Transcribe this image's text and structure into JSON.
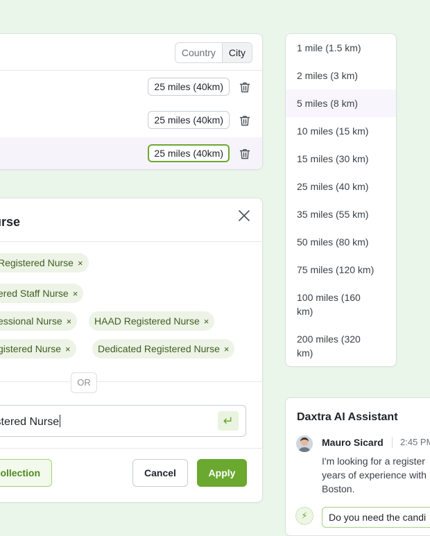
{
  "location": {
    "toggle": {
      "country": "Country",
      "city": "City",
      "active": "City"
    },
    "rows": [
      {
        "distance": "25 miles (40km)",
        "selected": false
      },
      {
        "distance": "25 miles (40km)",
        "selected": false
      },
      {
        "distance": "25 miles (40km)",
        "selected": true
      }
    ]
  },
  "distance_options": [
    "1 mile (1.5 km)",
    "2 miles (3 km)",
    "5 miles (8 km)",
    "10 miles (15 km)",
    "15 miles (30 km)",
    "25 miles (40 km)",
    "35 miles (55 km)",
    "50 miles (80 km)",
    "75 miles (120 km)",
    "100 miles (160 km)",
    "200 miles (320 km)"
  ],
  "distance_options_split": [
    [
      "1 mile (1.5 km)"
    ],
    [
      "2 miles (3 km)"
    ],
    [
      "5 miles (8 km)"
    ],
    [
      "10 miles (15 km)"
    ],
    [
      "15 miles (30 km)"
    ],
    [
      "25 miles (40 km)"
    ],
    [
      "35 miles (55 km)"
    ],
    [
      "50 miles (80 km)"
    ],
    [
      "75 miles (120 km)"
    ],
    [
      "100 miles (160",
      "km)"
    ],
    [
      "200 miles (320",
      "km)"
    ]
  ],
  "modal": {
    "title": "urse",
    "tags": [
      {
        "label": "Registered Nurse",
        "remove": "×"
      },
      {
        "label": "ered Staff Nurse",
        "remove": "×"
      },
      {
        "label": "essional Nurse",
        "remove": "×"
      },
      {
        "label": "HAAD Registered Nurse",
        "remove": "×"
      },
      {
        "label": "gistered Nurse",
        "remove": "×"
      },
      {
        "label": "Dedicated Registered Nurse",
        "remove": "×"
      }
    ],
    "or_label": "OR",
    "input_value": "istered Nurse",
    "enter_glyph": "↵",
    "buttons": {
      "collection": "ollection",
      "cancel": "Cancel",
      "apply": "Apply"
    }
  },
  "assistant": {
    "title": "Daxtra AI Assistant",
    "user": {
      "name": "Mauro Sicard",
      "time": "2:45 PM"
    },
    "message_lines": [
      "I'm looking for a register",
      "years of experience with",
      "Boston."
    ],
    "bot_badge": "⚡",
    "bot_reply": "Do you need the candi"
  },
  "colors": {
    "accent": "#6aa82f",
    "background": "#e9f6e9",
    "tag_bg": "#edf3e6"
  }
}
